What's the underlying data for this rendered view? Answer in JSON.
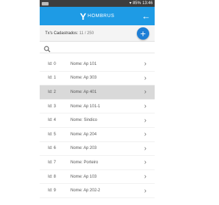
{
  "status": {
    "battery": "85%",
    "time": "13:46"
  },
  "header": {
    "logo_mark": "Y",
    "logo_text": "HOMBRUS",
    "back_icon": "arrow-left-icon"
  },
  "info": {
    "label": "Tx's Cadastrados:",
    "count": "11 / 250",
    "add_icon": "plus-icon"
  },
  "search": {
    "icon": "search-icon"
  },
  "list": {
    "items": [
      {
        "id_label": "Id: 0",
        "name_label": "Nome: Ap 101",
        "selected": false
      },
      {
        "id_label": "Id: 1",
        "name_label": "Nome: Ap 303",
        "selected": false
      },
      {
        "id_label": "Id: 2",
        "name_label": "Nome: Ap 401",
        "selected": true
      },
      {
        "id_label": "Id: 3",
        "name_label": "Nome: Ap 101-1",
        "selected": false
      },
      {
        "id_label": "Id: 4",
        "name_label": "Nome: Sindico",
        "selected": false
      },
      {
        "id_label": "Id: 5",
        "name_label": "Nome: Ap 204",
        "selected": false
      },
      {
        "id_label": "Id: 6",
        "name_label": "Nome: Ap 203",
        "selected": false
      },
      {
        "id_label": "Id: 7",
        "name_label": "Nome: Porteiro",
        "selected": false
      },
      {
        "id_label": "Id: 8",
        "name_label": "Nome: Ap 103",
        "selected": false
      },
      {
        "id_label": "Id: 9",
        "name_label": "Nome: Ap 202-2",
        "selected": false
      }
    ]
  },
  "colors": {
    "primary": "#1e9be5",
    "fab": "#1e7fd6",
    "selected_row": "#d9d9d9"
  }
}
